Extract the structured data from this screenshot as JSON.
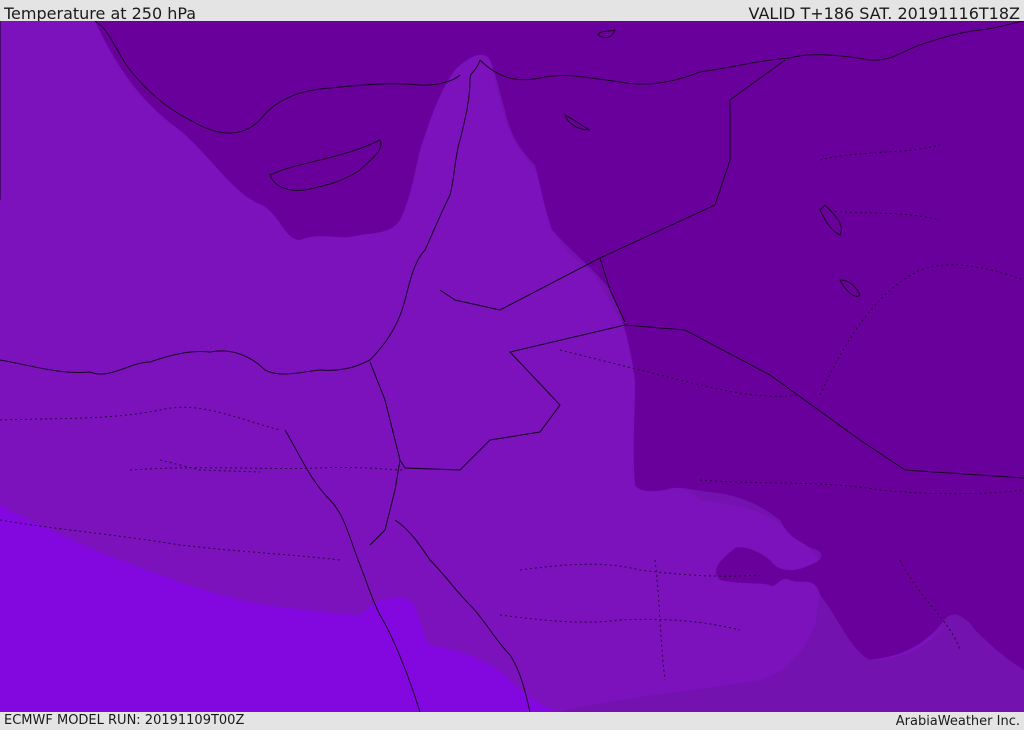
{
  "header": {
    "title": "Temperature at 250 hPa",
    "valid": "VALID T+186 SAT. 20191116T18Z"
  },
  "footer": {
    "model_run": "ECMWF MODEL RUN: 20191109T00Z",
    "credit": "ArabiaWeather Inc."
  },
  "map": {
    "colors": {
      "band_coldest": "#68009a",
      "band_cold": "#7412b0",
      "band_mid": "#7d12bd",
      "band_warm": "#8308de",
      "coastline": "#1a0024",
      "border": "#14001f"
    }
  }
}
